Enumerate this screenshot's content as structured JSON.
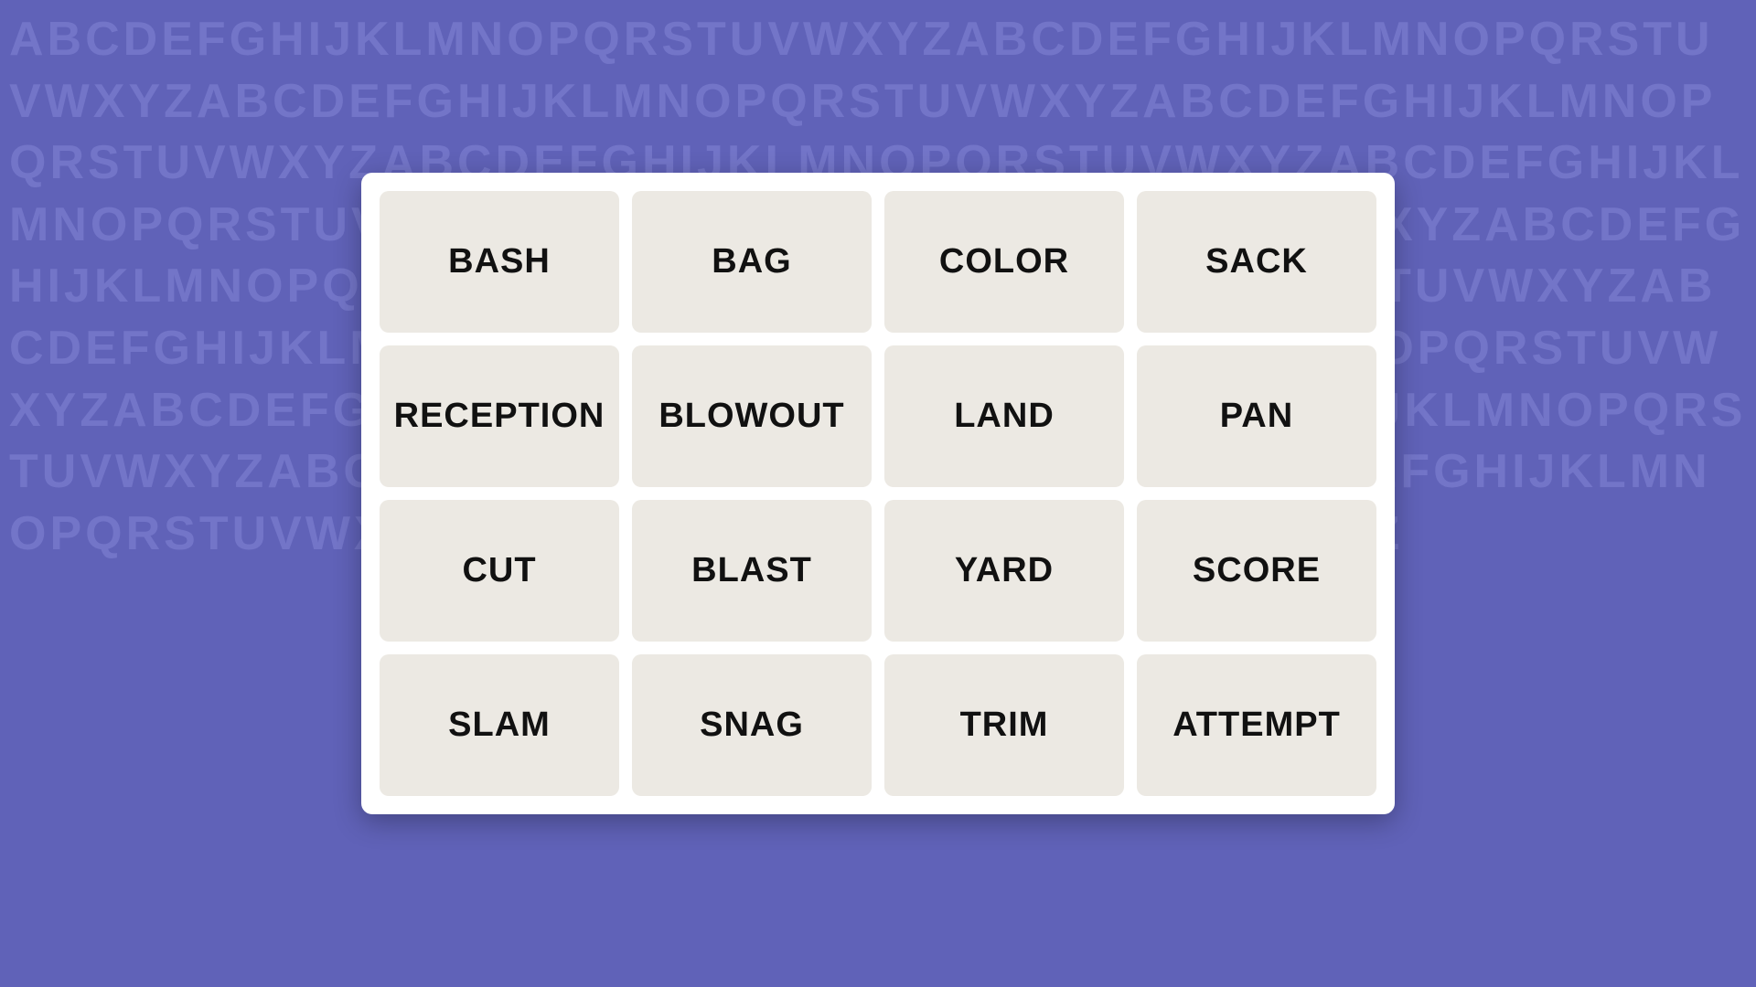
{
  "background": {
    "letters": "ABCDEFGHIJKLMNOPQRSTUVWXYZABCDEFGHIJKLMNOPQRSTUVWXYZABCDEFGHIJKLMNOPQRSTUVWXYZABCDEFGHIJKLMNOPQRSTUVWXYZABCDEFGHIJKLMNOPQRSTUVWXYZABCDEFGHIJKLMNOPQRSTUVWXYZABCDEFGHIJKLMNOPQRSTUVWXYZABCDEFGHIJKLMNOPQRSTUVWXYZABCDEFGHIJKLMNOPQRSTUVWXYZABCDEFGHIJKLMNOPQRSTUVWXYZABCDEFGHIJKLMNOPQRSTUVWXYZABCDEFGHIJKLMNOPQRSTUVWXYZABCDEFGHIJKLMNOPQRSTUVWXYZABCDEFGHIJKLMNOPQRSTUVWXYZABCDEFGHIJKLMNOPQRSTUVWXYZABCDEFGHIJKLMNOPQRSTUVWXYZ"
  },
  "grid": {
    "cells": [
      {
        "id": "bash",
        "label": "BASH"
      },
      {
        "id": "bag",
        "label": "BAG"
      },
      {
        "id": "color",
        "label": "COLOR"
      },
      {
        "id": "sack",
        "label": "SACK"
      },
      {
        "id": "reception",
        "label": "RECEPTION"
      },
      {
        "id": "blowout",
        "label": "BLOWOUT"
      },
      {
        "id": "land",
        "label": "LAND"
      },
      {
        "id": "pan",
        "label": "PAN"
      },
      {
        "id": "cut",
        "label": "CUT"
      },
      {
        "id": "blast",
        "label": "BLAST"
      },
      {
        "id": "yard",
        "label": "YARD"
      },
      {
        "id": "score",
        "label": "SCORE"
      },
      {
        "id": "slam",
        "label": "SLAM"
      },
      {
        "id": "snag",
        "label": "SNAG"
      },
      {
        "id": "trim",
        "label": "TRIM"
      },
      {
        "id": "attempt",
        "label": "ATTEMPT"
      }
    ]
  }
}
